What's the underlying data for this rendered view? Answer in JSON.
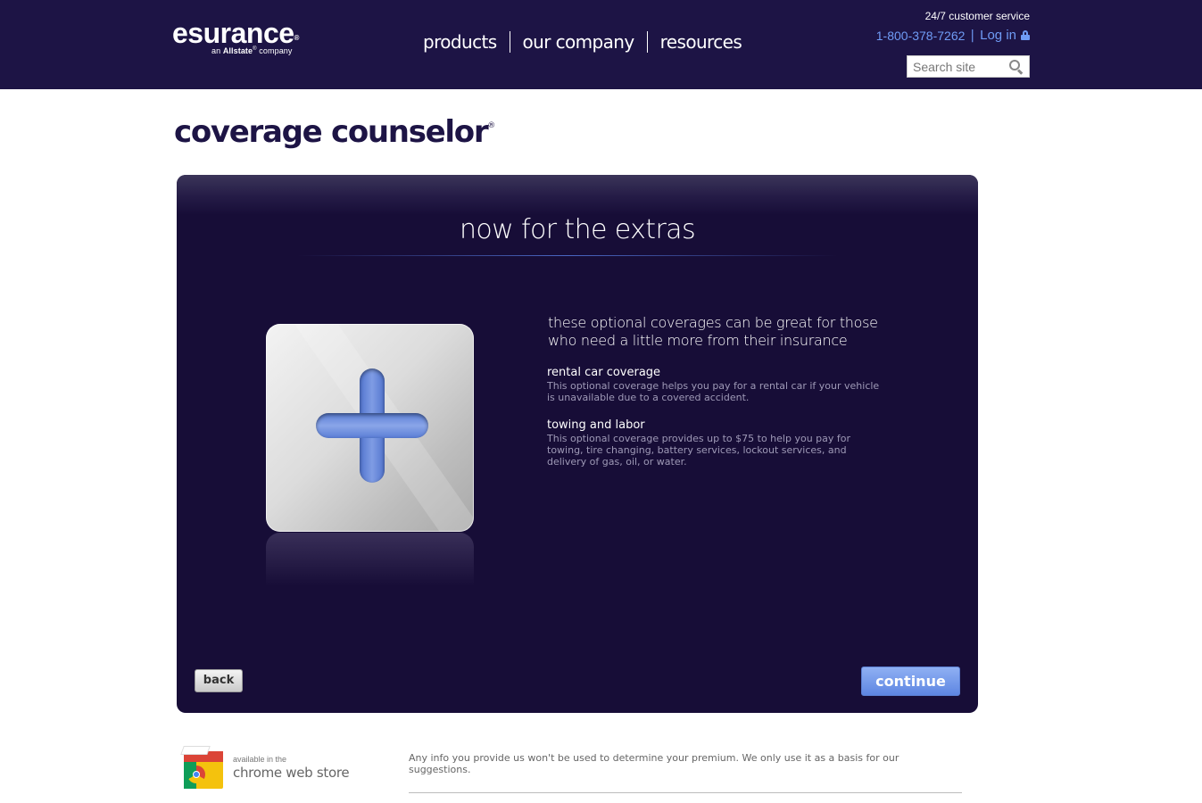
{
  "header": {
    "logo_main": "esurance",
    "logo_reg": "®",
    "logo_sub_prefix": "an",
    "logo_sub_brand": "Allstate",
    "logo_sub_suffix": "company",
    "nav": [
      "products",
      "our company",
      "resources"
    ],
    "service_title": "24/7 customer service",
    "phone": "1-800-378-7262",
    "pipe": "|",
    "login": "Log in",
    "search_placeholder": "Search site"
  },
  "page_title": "coverage counselor",
  "page_title_mark": "®",
  "panel": {
    "heading": "now for the extras",
    "intro": "these optional coverages can be great for those who need a little more from their insurance",
    "coverages": [
      {
        "title": "rental car coverage",
        "description": "This optional coverage helps you pay for a rental car if your vehicle is unavailable due to a covered accident."
      },
      {
        "title": "towing and labor",
        "description": "This optional coverage provides up to $75 to help you pay for towing, tire changing, battery services, lockout services, and delivery of gas, oil, or water."
      }
    ],
    "back_label": "back",
    "continue_label": "continue"
  },
  "footer": {
    "store_small": "available in the",
    "store_big": "chrome web store",
    "disclaimer": "Any info you provide us won't be used to determine your premium. We only use it as a basis for our suggestions."
  },
  "colors": {
    "header_bg": "#1d1445",
    "panel_bg": "#170d37",
    "link_blue": "#6f9bf5",
    "continue_blue": "#6d91e6"
  }
}
